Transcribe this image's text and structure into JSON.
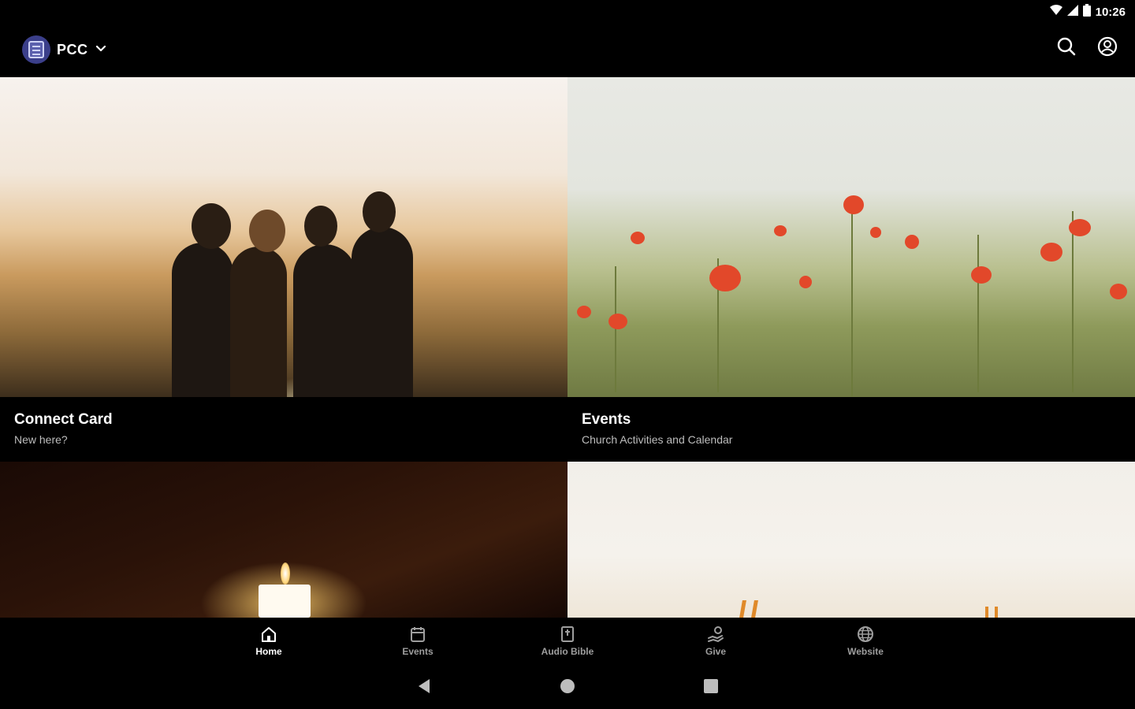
{
  "status_bar": {
    "time": "10:26"
  },
  "app_bar": {
    "brand_name": "PCC"
  },
  "cards": [
    {
      "title": "Connect Card",
      "subtitle": "New here?"
    },
    {
      "title": "Events",
      "subtitle": "Church Activities and Calendar"
    }
  ],
  "bottom_nav": {
    "items": [
      {
        "label": "Home",
        "icon": "home-icon",
        "active": true
      },
      {
        "label": "Events",
        "icon": "calendar-icon",
        "active": false
      },
      {
        "label": "Audio Bible",
        "icon": "bible-icon",
        "active": false
      },
      {
        "label": "Give",
        "icon": "give-icon",
        "active": false
      },
      {
        "label": "Website",
        "icon": "globe-icon",
        "active": false
      }
    ]
  },
  "colors": {
    "background": "#000000",
    "active_label": "#ffffff",
    "inactive_label": "#9e9e9e"
  }
}
